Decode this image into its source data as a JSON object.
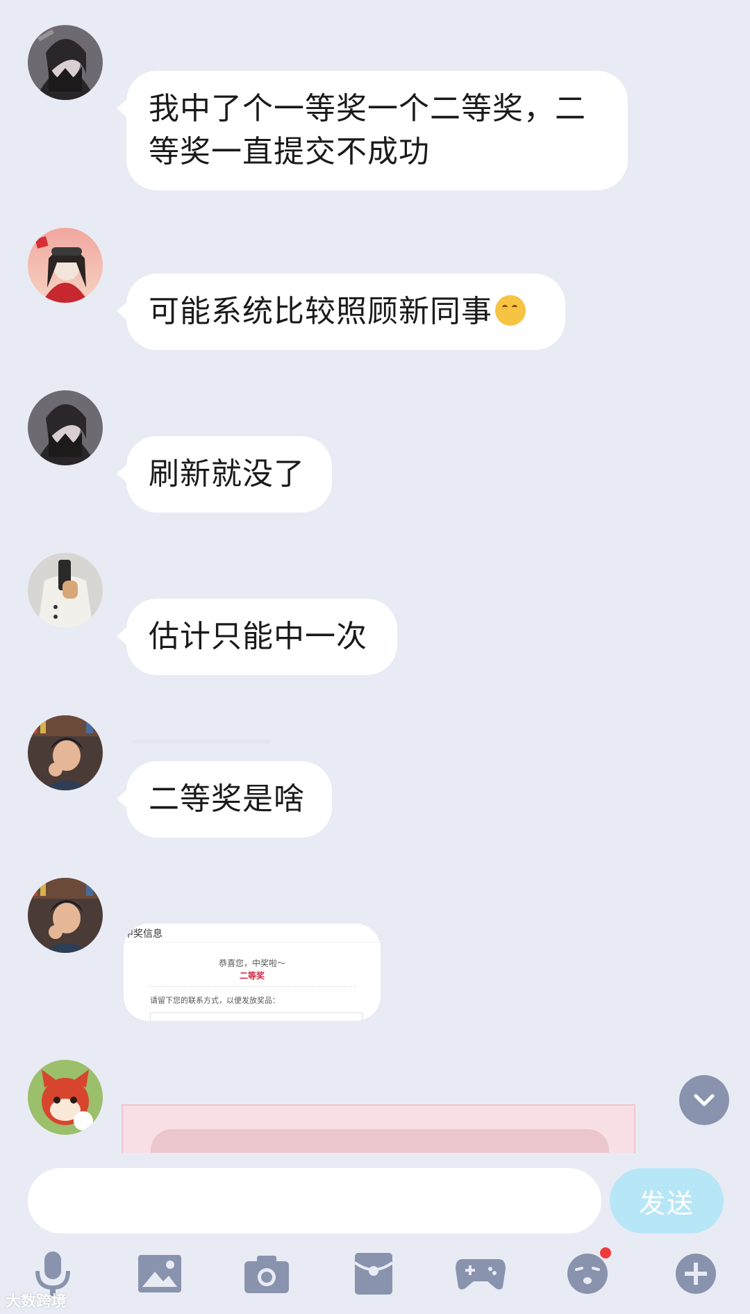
{
  "messages": [
    {
      "text": "我中了个一等奖一个二等奖，二等奖一直提交不成功"
    },
    {
      "text": "可能系统比较照顾新同事"
    },
    {
      "text": "刷新就没了"
    },
    {
      "text": "估计只能中一次"
    },
    {
      "text": "二等奖是啥"
    }
  ],
  "prize_card": {
    "title": "中奖信息",
    "congrats": "恭喜您，中奖啦～",
    "prize": "二等奖",
    "instruction": "请留下您的联系方式，以便发放奖品："
  },
  "input": {
    "value": "",
    "send_label": "发送"
  },
  "toolbar": {
    "icons": [
      "microphone-icon",
      "image-icon",
      "camera-icon",
      "red-packet-icon",
      "game-controller-icon",
      "emoji-icon",
      "plus-icon"
    ],
    "emoji_has_badge": true
  },
  "watermark": "大数跨境",
  "colors": {
    "background": "#e8ebf4",
    "bubble": "#ffffff",
    "send_button": "#b7e6f7",
    "icon": "#8a93ad",
    "prize_red": "#d0263e",
    "badge": "#ef3b3b"
  }
}
